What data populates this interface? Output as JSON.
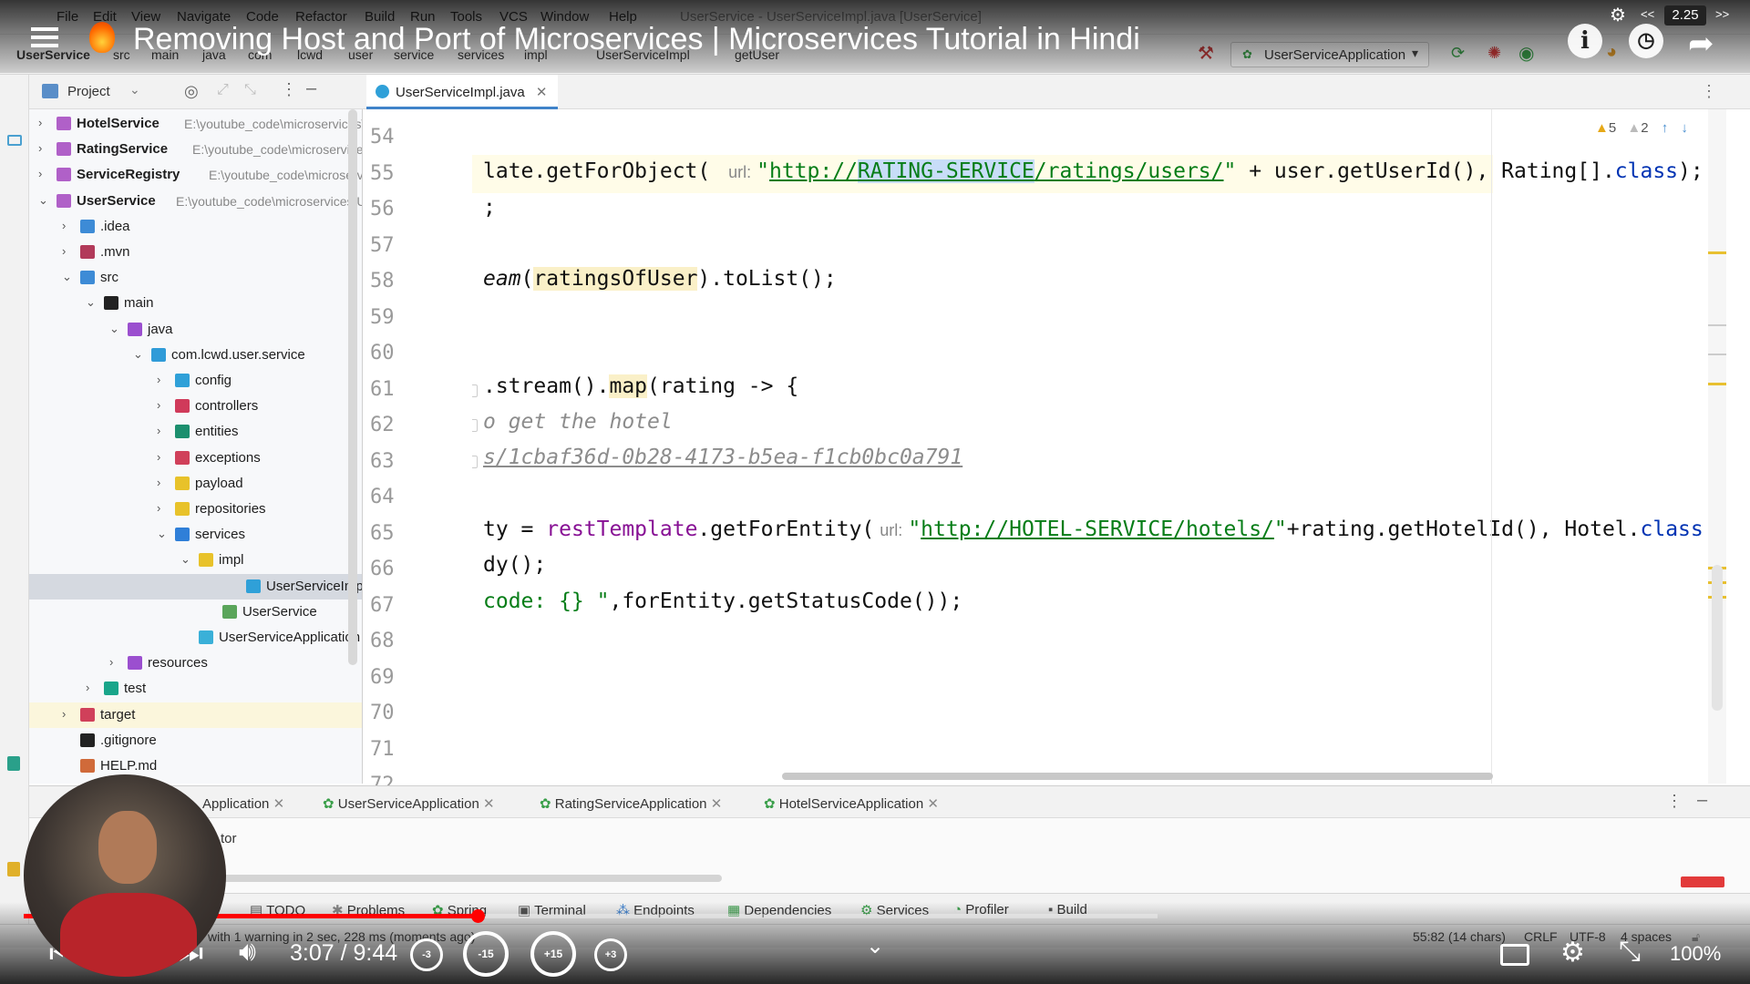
{
  "menu": [
    "File",
    "Edit",
    "View",
    "Navigate",
    "Code",
    "Refactor",
    "Build",
    "Run",
    "Tools",
    "VCS",
    "Window",
    "Help"
  ],
  "window_title": "UserService - UserServiceImpl.java [UserService]",
  "breadcrumbs": [
    "UserService",
    "src",
    "main",
    "java",
    "com",
    "lcwd",
    "user",
    "service",
    "services",
    "impl",
    "UserServiceImpl",
    "getUser"
  ],
  "run_config": "UserServiceApplication",
  "video": {
    "title": "Removing Host and Port of Microservices | Microservices Tutorial in Hindi",
    "time": "3:07 / 9:44",
    "played_fraction": 0.4,
    "speed": "2.25",
    "zoom": "100%",
    "skip_labels": [
      "-3",
      "-15",
      "+15",
      "+3"
    ]
  },
  "project": {
    "header": "Project",
    "rows": [
      {
        "label": "HotelService",
        "path": "E:\\youtube_code\\microservices\\",
        "bold": true,
        "chev": "›",
        "depth": 0,
        "color": "#b060c8"
      },
      {
        "label": "RatingService",
        "path": "E:\\youtube_code\\microservices\\",
        "bold": true,
        "chev": "›",
        "depth": 0,
        "color": "#b060c8"
      },
      {
        "label": "ServiceRegistry",
        "path": "E:\\youtube_code\\microservic",
        "bold": true,
        "chev": "›",
        "depth": 0,
        "color": "#b060c8"
      },
      {
        "label": "UserService",
        "path": "E:\\youtube_code\\microservices\\U",
        "bold": true,
        "chev": "⌄",
        "depth": 0,
        "color": "#b060c8"
      },
      {
        "label": ".idea",
        "path": "",
        "bold": false,
        "chev": "›",
        "depth": 1,
        "color": "#3d8bd6"
      },
      {
        "label": ".mvn",
        "path": "",
        "bold": false,
        "chev": "›",
        "depth": 1,
        "color": "#b23a5a"
      },
      {
        "label": "src",
        "path": "",
        "bold": false,
        "chev": "⌄",
        "depth": 1,
        "color": "#3d8bd6"
      },
      {
        "label": "main",
        "path": "",
        "bold": false,
        "chev": "⌄",
        "depth": 2,
        "color": "#222"
      },
      {
        "label": "java",
        "path": "",
        "bold": false,
        "chev": "⌄",
        "depth": 3,
        "color": "#9b4fcf"
      },
      {
        "label": "com.lcwd.user.service",
        "path": "",
        "bold": false,
        "chev": "⌄",
        "depth": 4,
        "color": "#2f9bd8"
      },
      {
        "label": "config",
        "path": "",
        "bold": false,
        "chev": "›",
        "depth": 5,
        "color": "#2fa0d8"
      },
      {
        "label": "controllers",
        "path": "",
        "bold": false,
        "chev": "›",
        "depth": 5,
        "color": "#d03a5a"
      },
      {
        "label": "entities",
        "path": "",
        "bold": false,
        "chev": "›",
        "depth": 5,
        "color": "#1c8f6e"
      },
      {
        "label": "exceptions",
        "path": "",
        "bold": false,
        "chev": "›",
        "depth": 5,
        "color": "#d0405a"
      },
      {
        "label": "payload",
        "path": "",
        "bold": false,
        "chev": "›",
        "depth": 5,
        "color": "#e8c22a"
      },
      {
        "label": "repositories",
        "path": "",
        "bold": false,
        "chev": "›",
        "depth": 5,
        "color": "#e8c22a"
      },
      {
        "label": "services",
        "path": "",
        "bold": false,
        "chev": "⌄",
        "depth": 5,
        "color": "#2f7fd8"
      },
      {
        "label": "impl",
        "path": "",
        "bold": false,
        "chev": "⌄",
        "depth": 6,
        "color": "#e8c22a"
      },
      {
        "label": "UserServiceImpl",
        "path": "",
        "bold": false,
        "chev": "",
        "depth": 8,
        "color": "#2fa0d8",
        "selected": true
      },
      {
        "label": "UserService",
        "path": "",
        "bold": false,
        "chev": "",
        "depth": 7,
        "color": "#5aa55a"
      },
      {
        "label": "UserServiceApplication",
        "path": "",
        "bold": false,
        "chev": "",
        "depth": 6,
        "color": "#3ab0d8"
      },
      {
        "label": "resources",
        "path": "",
        "bold": false,
        "chev": "›",
        "depth": 3,
        "color": "#9b4fcf"
      },
      {
        "label": "test",
        "path": "",
        "bold": false,
        "chev": "›",
        "depth": 2,
        "color": "#1aa58a"
      },
      {
        "label": "target",
        "path": "",
        "bold": false,
        "chev": "›",
        "depth": 1,
        "color": "#d0405a",
        "hl": true
      },
      {
        "label": ".gitignore",
        "path": "",
        "bold": false,
        "chev": "",
        "depth": 1,
        "color": "#222"
      },
      {
        "label": "HELP.md",
        "path": "",
        "bold": false,
        "chev": "",
        "depth": 1,
        "color": "#d06a3a"
      }
    ]
  },
  "editor": {
    "tab": "UserServiceImpl.java",
    "warnings": "5",
    "weak_warnings": "2",
    "line_numbers": [
      "54",
      "55",
      "56",
      "57",
      "58",
      "59",
      "60",
      "61",
      "62",
      "63",
      "64",
      "65",
      "66",
      "67",
      "68",
      "69",
      "70",
      "71",
      "72"
    ],
    "line55": {
      "a": "late.getForObject(",
      "hint": "url:",
      "q1": "\"",
      "p1": "http://",
      "sel": "RATING-SERVICE",
      "p2": "/ratings/users/",
      "q2": "\"",
      "b": " + user.getUserId(), Rating[].",
      "kw": "class",
      "c": ");"
    },
    "line56": ";",
    "line58": {
      "a": "eam",
      "b": "(",
      "box": "ratingsOfUser",
      "c": ").toList();"
    },
    "line61": {
      "a": ".stream().",
      "m": "map",
      "b": "(rating -> {"
    },
    "line62": "o get the hotel",
    "line63": "s/1cbaf36d-0b28-4173-b5ea-f1cb0bc0a791",
    "line65": {
      "a": "ty = ",
      "f": "restTemplate",
      "b": ".getForEntity(",
      "hint": "url:",
      "q1": "\"",
      "u": "http://HOTEL-SERVICE/hotels/",
      "q2": "\"",
      "c": "+rating.getHotelId(), Hotel.",
      "kw": "class"
    },
    "line66": "dy();",
    "line67": {
      "s": "code: {} \"",
      "c": ",forEntity.getStatusCode());"
    }
  },
  "run_tabs": [
    "Application",
    "UserServiceApplication",
    "RatingServiceApplication",
    "HotelServiceApplication"
  ],
  "run_body_text": "tor",
  "tool_tabs": [
    "TODO",
    "Problems",
    "Spring",
    "Terminal",
    "Endpoints",
    "Dependencies",
    "Services",
    "Profiler",
    "Build"
  ],
  "status": {
    "message": "with 1 warning in 2 sec, 228 ms (moments ago)",
    "position": "55:82 (14 chars)",
    "line_sep": "CRLF",
    "encoding": "UTF-8",
    "indent": "4 spaces"
  }
}
